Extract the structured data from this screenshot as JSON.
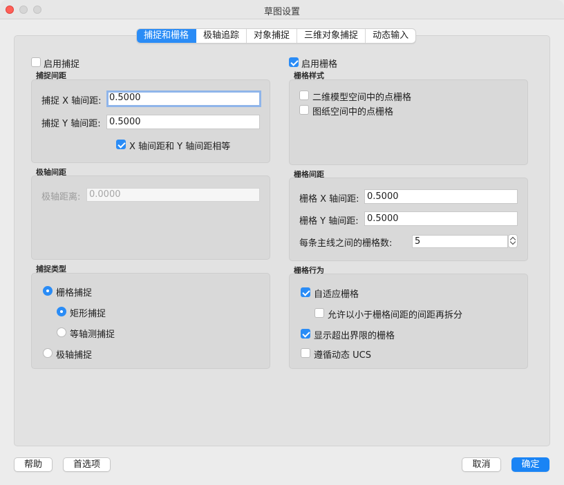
{
  "window": {
    "title": "草图设置"
  },
  "tabs": [
    {
      "label": "捕捉和栅格",
      "active": true
    },
    {
      "label": "极轴追踪",
      "active": false
    },
    {
      "label": "对象捕捉",
      "active": false
    },
    {
      "label": "三维对象捕捉",
      "active": false
    },
    {
      "label": "动态输入",
      "active": false
    }
  ],
  "snap": {
    "enable_label": "启用捕捉",
    "enabled": false,
    "spacing_group": "捕捉间距",
    "x_label": "捕捉 X 轴间距:",
    "x_value": "0.5000",
    "y_label": "捕捉 Y 轴间距:",
    "y_value": "0.5000",
    "equal_label": "X 轴间距和 Y 轴间距相等",
    "equal_checked": true
  },
  "polar": {
    "group": "极轴间距",
    "distance_label": "极轴距离:",
    "distance_value": "0.0000"
  },
  "snap_type": {
    "group": "捕捉类型",
    "grid_snap": "栅格捕捉",
    "rect_snap": "矩形捕捉",
    "iso_snap": "等轴测捕捉",
    "polar_snap": "极轴捕捉",
    "selected": "grid_snap",
    "sub_selected": "rect_snap"
  },
  "grid": {
    "enable_label": "启用栅格",
    "enabled": true,
    "style_group": "栅格样式",
    "style_2d": "二维模型空间中的点栅格",
    "style_paper": "图纸空间中的点栅格",
    "spacing_group": "栅格间距",
    "x_label": "栅格 X 轴间距:",
    "x_value": "0.5000",
    "y_label": "栅格 Y 轴间距:",
    "y_value": "0.5000",
    "major_label": "每条主线之间的栅格数:",
    "major_value": "5",
    "behavior_group": "栅格行为",
    "adaptive": "自适应栅格",
    "adaptive_checked": true,
    "subdivide": "允许以小于栅格间距的间距再拆分",
    "subdivide_checked": false,
    "beyond_limits": "显示超出界限的栅格",
    "beyond_limits_checked": true,
    "follow_ucs": "遵循动态 UCS",
    "follow_ucs_checked": false
  },
  "footer": {
    "help": "帮助",
    "options": "首选项",
    "cancel": "取消",
    "ok": "确定"
  },
  "colors": {
    "accent": "#2a8cf6",
    "primary_button": "#1a84f5",
    "close": "#ff5f57"
  }
}
